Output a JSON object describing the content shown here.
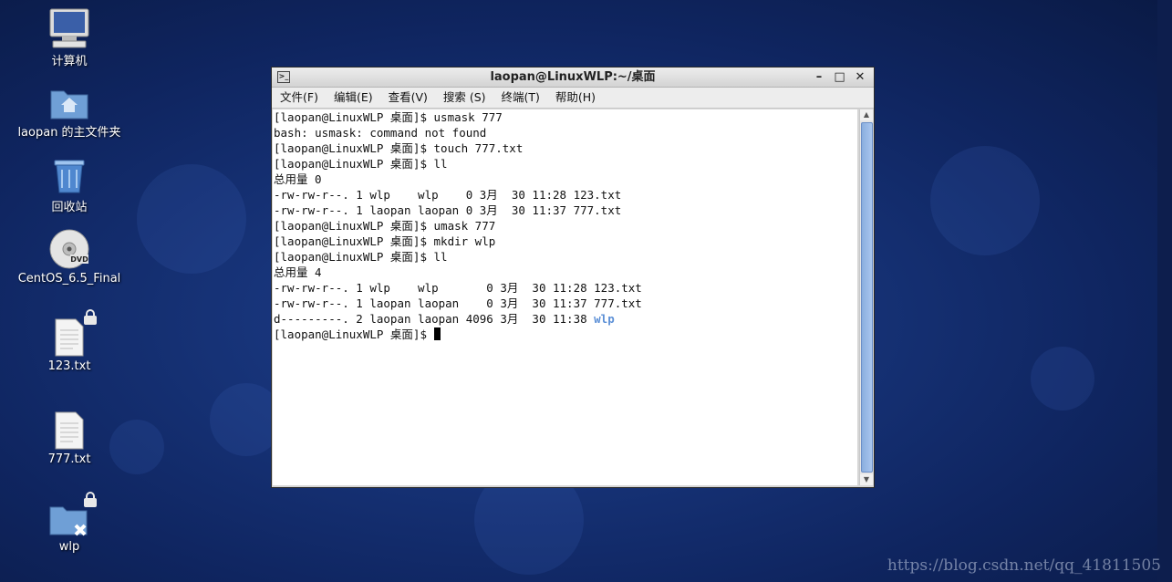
{
  "desktop": {
    "icons": [
      {
        "label": "计算机",
        "icon": "computer-icon"
      },
      {
        "label": "laopan 的主文件夹",
        "icon": "home-folder-icon"
      },
      {
        "label": "回收站",
        "icon": "trash-icon"
      },
      {
        "label": "CentOS_6.5_Final",
        "icon": "dvd-icon"
      },
      {
        "label": "123.txt",
        "icon": "text-file-icon"
      },
      {
        "label": "777.txt",
        "icon": "text-file-icon"
      },
      {
        "label": "wlp",
        "icon": "folder-icon"
      }
    ],
    "watermark": "https://blog.csdn.net/qq_41811505"
  },
  "window": {
    "title": "laopan@LinuxWLP:~/桌面",
    "controls": {
      "minimize": "–",
      "maximize": "□",
      "close": "✕"
    },
    "menu": [
      "文件(F)",
      "编辑(E)",
      "查看(V)",
      "搜索 (S)",
      "终端(T)",
      "帮助(H)"
    ]
  },
  "terminal": {
    "lines": [
      "[laopan@LinuxWLP 桌面]$ usmask 777",
      "bash: usmask: command not found",
      "[laopan@LinuxWLP 桌面]$ touch 777.txt",
      "[laopan@LinuxWLP 桌面]$ ll",
      "总用量 0",
      "-rw-rw-r--. 1 wlp    wlp    0 3月  30 11:28 123.txt",
      "-rw-rw-r--. 1 laopan laopan 0 3月  30 11:37 777.txt",
      "[laopan@LinuxWLP 桌面]$ umask 777",
      "[laopan@LinuxWLP 桌面]$ mkdir wlp",
      "[laopan@LinuxWLP 桌面]$ ll",
      "总用量 4",
      "-rw-rw-r--. 1 wlp    wlp       0 3月  30 11:28 123.txt",
      "-rw-rw-r--. 1 laopan laopan    0 3月  30 11:37 777.txt"
    ],
    "dir_line_prefix": "d---------. 2 laopan laopan 4096 3月  30 11:38 ",
    "dir_name": "wlp",
    "prompt": "[laopan@LinuxWLP 桌面]$ "
  },
  "colors": {
    "desktop_bg": "#163276",
    "dir_listing": "#5b8fd6"
  }
}
